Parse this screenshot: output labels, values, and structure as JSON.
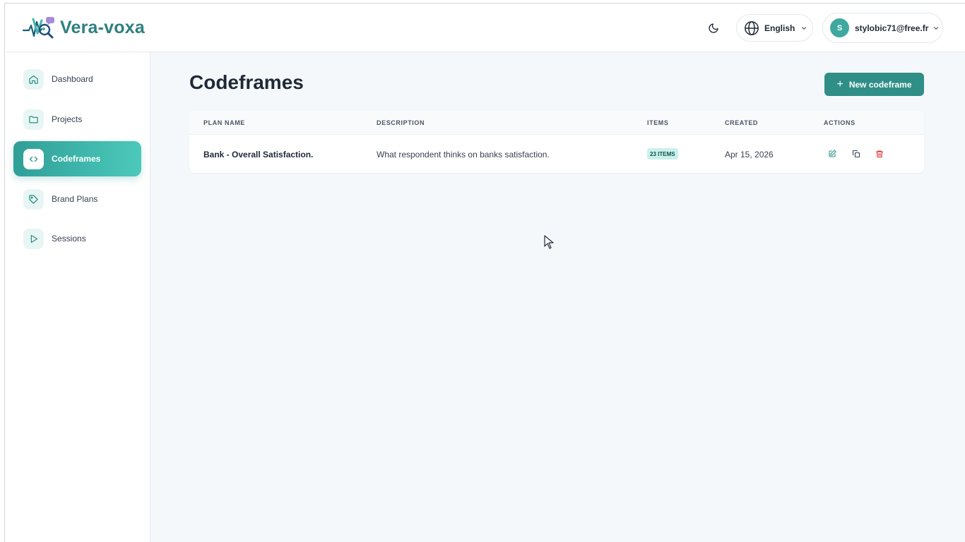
{
  "app": {
    "name": "Vera-voxa"
  },
  "header": {
    "language": "English",
    "user_initial": "S",
    "user_email": "stylobic71@free.fr"
  },
  "sidebar": {
    "items": [
      {
        "label": "Dashboard",
        "icon": "home-icon"
      },
      {
        "label": "Projects",
        "icon": "folder-icon"
      },
      {
        "label": "Codeframes",
        "icon": "code-icon",
        "active": true
      },
      {
        "label": "Brand Plans",
        "icon": "tag-icon"
      },
      {
        "label": "Sessions",
        "icon": "play-icon"
      }
    ]
  },
  "main": {
    "title": "Codeframes",
    "new_button": "New codeframe",
    "table": {
      "columns": [
        "PLAN NAME",
        "DESCRIPTION",
        "ITEMS",
        "CREATED",
        "ACTIONS"
      ],
      "rows": [
        {
          "plan_name": "Bank - Overall Satisfaction.",
          "description": "What respondent thinks on banks satisfaction.",
          "items": "23 ITEMS",
          "created": "Apr 15, 2026"
        }
      ]
    }
  },
  "colors": {
    "brand": "#2f7f7f",
    "accent": "#2f8f87",
    "delete": "#dc2626"
  }
}
